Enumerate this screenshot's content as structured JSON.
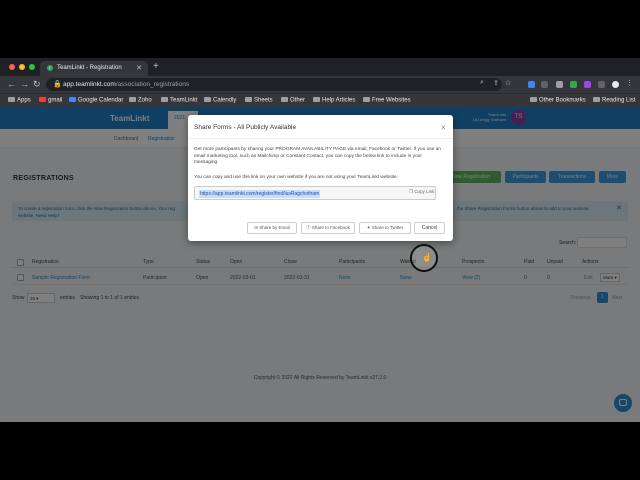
{
  "browser": {
    "tab_title": "TeamLinkt - Registration",
    "url_host": "app.teamlinkt.com",
    "url_path": "/association_registrations",
    "bookmarks": [
      "Apps",
      "gmail",
      "Google Calendar",
      "Zoho",
      "TeamLinkt",
      "Calendly",
      "Sheets",
      "Other",
      "Help Articles",
      "Free Websites"
    ],
    "other_bookmarks": "Other Bookmarks",
    "reading_list": "Reading List"
  },
  "header": {
    "logo": "TeamLinkt",
    "tab": "2021",
    "user_line1": "TeamLinkt",
    "user_line2": "Lil-Gregg Gratham",
    "avatar": "TS"
  },
  "subnav": {
    "dashboard": "Dashboard",
    "registration": "Registration"
  },
  "page": {
    "title": "REGISTRATIONS",
    "actions": {
      "new_registration": "New Registration",
      "participants": "Participants",
      "transactions": "Transactions",
      "more": "More"
    },
    "alert_left": "To create a registration form, click the New Registration button above. Your reg",
    "alert_right": "the Share Registration Forms button above to add to your website.",
    "alert_line2_prefix": "website.",
    "alert_link": "Need Help?",
    "search_label": "Search:"
  },
  "table": {
    "headers": [
      "Registration",
      "Type",
      "Status",
      "Open",
      "Close",
      "Participants",
      "Waitlist",
      "Prospects",
      "Paid",
      "Unpaid",
      "Actions"
    ],
    "row": {
      "registration": "Sample Registration Form",
      "type": "Participant",
      "status": "Open",
      "open": "2022-03-01",
      "close": "2022-03-31",
      "participants": "None",
      "waitlist": "None",
      "prospects": "View (2)",
      "paid": "0",
      "unpaid": "0",
      "edit": "Edit",
      "more": "More"
    },
    "show_label": "Show",
    "show_value": "25",
    "entries_label": "entries",
    "showing": "Showing 1 to 1 of 1 entries",
    "previous": "Previous",
    "page": "1",
    "next": "Next"
  },
  "footer": {
    "copyright": "Copyright © 2022 All Rights Reserved by TeamLinkt v27.2.0"
  },
  "modal": {
    "title": "Share Forms - All Publicly Available",
    "description": "Get more participants by sharing your PROGRAM AVAILABILITY PAGE via email, Facebook or Twitter. If you use an email marketing tool, such as Mailchimp or Constant Contact, you can copy the below link to include in your messaging.",
    "note": "You can copy and use this link on your own website if you are not using your TeamLinkt website.",
    "url": "https://app.teamlinkt.com/register/find/lusRagchotham",
    "copy_link": "Copy Link",
    "share_email": "Share by Email",
    "share_facebook": "Share to Facebook",
    "share_twitter": "Share to Twitter",
    "cancel": "Cancel"
  },
  "colors": {
    "brand_blue": "#1f7fc6",
    "green_button": "#5cb85c",
    "link_blue": "#2b8fd6",
    "avatar_purple": "#8e3fa6"
  }
}
